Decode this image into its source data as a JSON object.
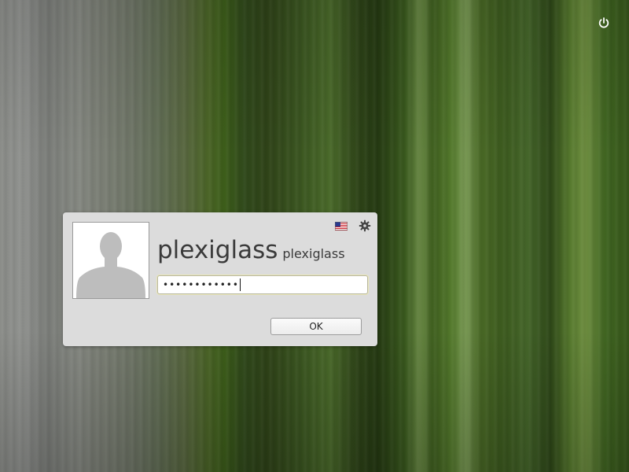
{
  "top_bar": {
    "power_icon": "power-icon"
  },
  "login": {
    "avatar_icon": "user-silhouette-icon",
    "real_name": "plexiglass",
    "username": "plexiglass",
    "password_masked": "••••••••••••",
    "keyboard_layout_icon": "us-flag-icon",
    "session_icon": "gear-icon",
    "ok_label": "OK"
  },
  "colors": {
    "dialog_bg": "#dcdcdc",
    "field_focus": "#e9e6b8",
    "wallpaper_green": "#3d5e1a"
  }
}
